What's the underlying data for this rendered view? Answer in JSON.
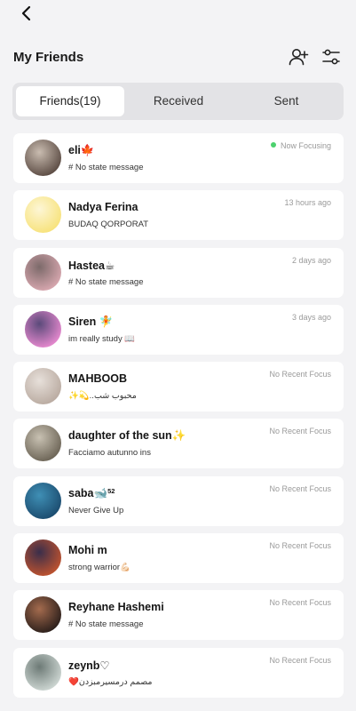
{
  "header": {
    "title": "My Friends"
  },
  "tabs": [
    {
      "label": "Friends(19)",
      "active": true
    },
    {
      "label": "Received",
      "active": false
    },
    {
      "label": "Sent",
      "active": false
    }
  ],
  "friends": [
    {
      "name": "eli🍁",
      "message": "# No state message",
      "status": "Now Focusing",
      "focusing": true,
      "avatar_colors": [
        "#5a4a42",
        "#c9bcb0"
      ]
    },
    {
      "name": "Nadya Ferina",
      "message": "BUDAQ QORPORAT",
      "status": "13 hours ago",
      "avatar_colors": [
        "#f7e27a",
        "#fdf6d6"
      ]
    },
    {
      "name": "Hastea☕",
      "message": "# No state message",
      "status": "2 days ago",
      "avatar_colors": [
        "#d9a8b0",
        "#7c6a6a"
      ]
    },
    {
      "name": "Siren 🧚",
      "message": "im really study 📖",
      "status": "3 days ago",
      "avatar_colors": [
        "#e88ad0",
        "#5b4a7a"
      ]
    },
    {
      "name": "MAHBOOB",
      "message": "✨💫..محبوب شب",
      "status": "No Recent Focus",
      "avatar_colors": [
        "#b9aaa0",
        "#e7e0da"
      ]
    },
    {
      "name": "daughter of the sun✨",
      "message": "Facciamo autunno ins",
      "status": "No Recent Focus",
      "avatar_colors": [
        "#6b6355",
        "#c8c1b2"
      ]
    },
    {
      "name": "saba🐋",
      "name_sup": "52",
      "message": "Never Give Up",
      "status": "No Recent Focus",
      "avatar_colors": [
        "#1b4b6e",
        "#3f8fb5"
      ]
    },
    {
      "name": "Mohi m",
      "message": "strong warrior💪🏻",
      "status": "No Recent Focus",
      "avatar_colors": [
        "#c0532f",
        "#3a2e4a"
      ]
    },
    {
      "name": "Reyhane Hashemi",
      "message": "# No state message",
      "status": "No Recent Focus",
      "avatar_colors": [
        "#2a1e1a",
        "#a46b4e"
      ]
    },
    {
      "name": "zeynb♡",
      "message": "❤️مصمم درمسیرمبزدن",
      "status": "No Recent Focus",
      "avatar_colors": [
        "#cfd8d4",
        "#6d7a76"
      ]
    }
  ]
}
